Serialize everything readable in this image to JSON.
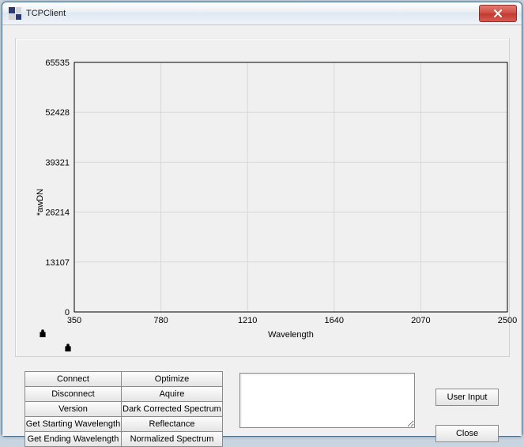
{
  "window": {
    "title": "TCPClient"
  },
  "chart_data": {
    "type": "line",
    "title": "",
    "xlabel": "Wavelength",
    "ylabel": "*awDN",
    "xlim": [
      350,
      2500
    ],
    "ylim": [
      0,
      65535
    ],
    "xticks": [
      350,
      780,
      1210,
      1640,
      2070,
      2500
    ],
    "yticks": [
      0,
      13107,
      26214,
      39321,
      52428,
      65535
    ],
    "series": [
      {
        "name": "RawDN",
        "x": [],
        "y": []
      }
    ],
    "grid": true,
    "legend": false
  },
  "buttons": {
    "col1": [
      "Connect",
      "Disconnect",
      "Version",
      "Get Starting Wavelength",
      "Get Ending Wavelength"
    ],
    "col2": [
      "Optimize",
      "Aquire",
      "Dark Corrected Spectrum",
      "Reflectance",
      "Normalized Spectrum"
    ]
  },
  "side": {
    "user_input": "User Input",
    "close": "Close"
  },
  "output": ""
}
